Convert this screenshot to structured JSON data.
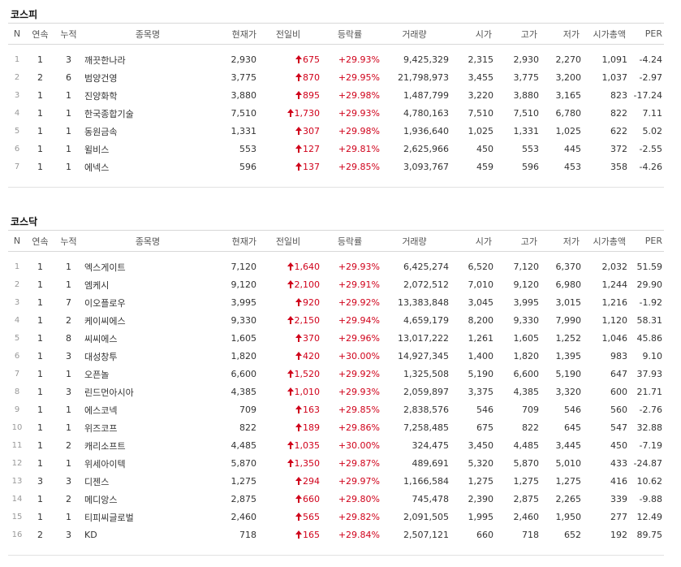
{
  "columns": [
    "N",
    "연속",
    "누적",
    "종목명",
    "현재가",
    "전일비",
    "등락률",
    "거래량",
    "시가",
    "고가",
    "저가",
    "시가총액",
    "PER"
  ],
  "kospi": {
    "title": "코스피",
    "rows": [
      {
        "n": "1",
        "consec": "1",
        "cum": "3",
        "name": "깨끗한나라",
        "price": "2,930",
        "change": "675",
        "rate": "+29.93%",
        "volume": "9,425,329",
        "open": "2,315",
        "high": "2,930",
        "low": "2,270",
        "mcap": "1,091",
        "per": "-4.24"
      },
      {
        "n": "2",
        "consec": "2",
        "cum": "6",
        "name": "범양건영",
        "price": "3,775",
        "change": "870",
        "rate": "+29.95%",
        "volume": "21,798,973",
        "open": "3,455",
        "high": "3,775",
        "low": "3,200",
        "mcap": "1,037",
        "per": "-2.97"
      },
      {
        "n": "3",
        "consec": "1",
        "cum": "1",
        "name": "진양화학",
        "price": "3,880",
        "change": "895",
        "rate": "+29.98%",
        "volume": "1,487,799",
        "open": "3,220",
        "high": "3,880",
        "low": "3,165",
        "mcap": "823",
        "per": "-17.24"
      },
      {
        "n": "4",
        "consec": "1",
        "cum": "1",
        "name": "한국종합기술",
        "price": "7,510",
        "change": "1,730",
        "rate": "+29.93%",
        "volume": "4,780,163",
        "open": "7,510",
        "high": "7,510",
        "low": "6,780",
        "mcap": "822",
        "per": "7.11"
      },
      {
        "n": "5",
        "consec": "1",
        "cum": "1",
        "name": "동원금속",
        "price": "1,331",
        "change": "307",
        "rate": "+29.98%",
        "volume": "1,936,640",
        "open": "1,025",
        "high": "1,331",
        "low": "1,025",
        "mcap": "622",
        "per": "5.02"
      },
      {
        "n": "6",
        "consec": "1",
        "cum": "1",
        "name": "윌비스",
        "price": "553",
        "change": "127",
        "rate": "+29.81%",
        "volume": "2,625,966",
        "open": "450",
        "high": "553",
        "low": "445",
        "mcap": "372",
        "per": "-2.55"
      },
      {
        "n": "7",
        "consec": "1",
        "cum": "1",
        "name": "에넥스",
        "price": "596",
        "change": "137",
        "rate": "+29.85%",
        "volume": "3,093,767",
        "open": "459",
        "high": "596",
        "low": "453",
        "mcap": "358",
        "per": "-4.26"
      }
    ]
  },
  "kosdaq": {
    "title": "코스닥",
    "rows": [
      {
        "n": "1",
        "consec": "1",
        "cum": "1",
        "name": "엑스게이트",
        "price": "7,120",
        "change": "1,640",
        "rate": "+29.93%",
        "volume": "6,425,274",
        "open": "6,520",
        "high": "7,120",
        "low": "6,370",
        "mcap": "2,032",
        "per": "51.59"
      },
      {
        "n": "2",
        "consec": "1",
        "cum": "1",
        "name": "엠케시",
        "price": "9,120",
        "change": "2,100",
        "rate": "+29.91%",
        "volume": "2,072,512",
        "open": "7,010",
        "high": "9,120",
        "low": "6,980",
        "mcap": "1,244",
        "per": "29.90"
      },
      {
        "n": "3",
        "consec": "1",
        "cum": "7",
        "name": "이오플로우",
        "price": "3,995",
        "change": "920",
        "rate": "+29.92%",
        "volume": "13,383,848",
        "open": "3,045",
        "high": "3,995",
        "low": "3,015",
        "mcap": "1,216",
        "per": "-1.92"
      },
      {
        "n": "4",
        "consec": "1",
        "cum": "2",
        "name": "케이씨에스",
        "price": "9,330",
        "change": "2,150",
        "rate": "+29.94%",
        "volume": "4,659,179",
        "open": "8,200",
        "high": "9,330",
        "low": "7,990",
        "mcap": "1,120",
        "per": "58.31"
      },
      {
        "n": "5",
        "consec": "1",
        "cum": "8",
        "name": "씨씨에스",
        "price": "1,605",
        "change": "370",
        "rate": "+29.96%",
        "volume": "13,017,222",
        "open": "1,261",
        "high": "1,605",
        "low": "1,252",
        "mcap": "1,046",
        "per": "45.86"
      },
      {
        "n": "6",
        "consec": "1",
        "cum": "3",
        "name": "대성창투",
        "price": "1,820",
        "change": "420",
        "rate": "+30.00%",
        "volume": "14,927,345",
        "open": "1,400",
        "high": "1,820",
        "low": "1,395",
        "mcap": "983",
        "per": "9.10"
      },
      {
        "n": "7",
        "consec": "1",
        "cum": "1",
        "name": "오픈놀",
        "price": "6,600",
        "change": "1,520",
        "rate": "+29.92%",
        "volume": "1,325,508",
        "open": "5,190",
        "high": "6,600",
        "low": "5,190",
        "mcap": "647",
        "per": "37.93"
      },
      {
        "n": "8",
        "consec": "1",
        "cum": "3",
        "name": "린드먼아시아",
        "price": "4,385",
        "change": "1,010",
        "rate": "+29.93%",
        "volume": "2,059,897",
        "open": "3,375",
        "high": "4,385",
        "low": "3,320",
        "mcap": "600",
        "per": "21.71"
      },
      {
        "n": "9",
        "consec": "1",
        "cum": "1",
        "name": "에스코넥",
        "price": "709",
        "change": "163",
        "rate": "+29.85%",
        "volume": "2,838,576",
        "open": "546",
        "high": "709",
        "low": "546",
        "mcap": "560",
        "per": "-2.76"
      },
      {
        "n": "10",
        "consec": "1",
        "cum": "1",
        "name": "위즈코프",
        "price": "822",
        "change": "189",
        "rate": "+29.86%",
        "volume": "7,258,485",
        "open": "675",
        "high": "822",
        "low": "645",
        "mcap": "547",
        "per": "32.88"
      },
      {
        "n": "11",
        "consec": "1",
        "cum": "2",
        "name": "캐리소프트",
        "price": "4,485",
        "change": "1,035",
        "rate": "+30.00%",
        "volume": "324,475",
        "open": "3,450",
        "high": "4,485",
        "low": "3,445",
        "mcap": "450",
        "per": "-7.19"
      },
      {
        "n": "12",
        "consec": "1",
        "cum": "1",
        "name": "위세아이텍",
        "price": "5,870",
        "change": "1,350",
        "rate": "+29.87%",
        "volume": "489,691",
        "open": "5,320",
        "high": "5,870",
        "low": "5,010",
        "mcap": "433",
        "per": "-24.87"
      },
      {
        "n": "13",
        "consec": "3",
        "cum": "3",
        "name": "디젠스",
        "price": "1,275",
        "change": "294",
        "rate": "+29.97%",
        "volume": "1,166,584",
        "open": "1,275",
        "high": "1,275",
        "low": "1,275",
        "mcap": "416",
        "per": "10.62"
      },
      {
        "n": "14",
        "consec": "1",
        "cum": "2",
        "name": "메디앙스",
        "price": "2,875",
        "change": "660",
        "rate": "+29.80%",
        "volume": "745,478",
        "open": "2,390",
        "high": "2,875",
        "low": "2,265",
        "mcap": "339",
        "per": "-9.88"
      },
      {
        "n": "15",
        "consec": "1",
        "cum": "1",
        "name": "티피씨글로벌",
        "price": "2,460",
        "change": "565",
        "rate": "+29.82%",
        "volume": "2,091,505",
        "open": "1,995",
        "high": "2,460",
        "low": "1,950",
        "mcap": "277",
        "per": "12.49"
      },
      {
        "n": "16",
        "consec": "2",
        "cum": "3",
        "name": "KD",
        "price": "718",
        "change": "165",
        "rate": "+29.84%",
        "volume": "2,507,121",
        "open": "660",
        "high": "718",
        "low": "652",
        "mcap": "192",
        "per": "89.75"
      }
    ]
  }
}
